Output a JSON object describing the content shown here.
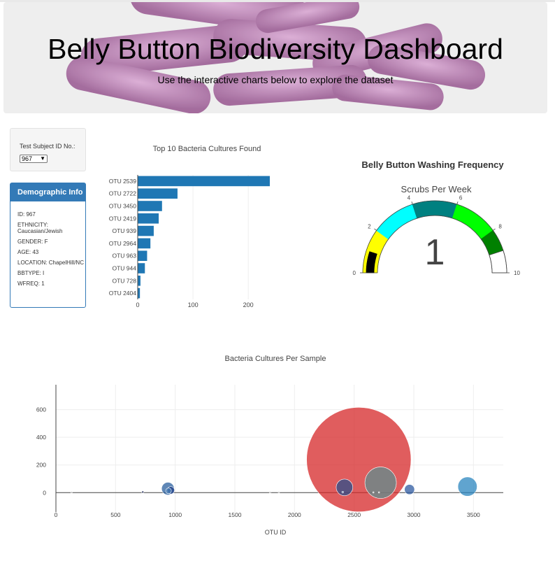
{
  "header": {
    "title": "Belly Button Biodiversity Dashboard",
    "subtitle": "Use the interactive charts below to explore the dataset"
  },
  "selector": {
    "label": "Test Subject ID No.:",
    "value": "967"
  },
  "demographics": {
    "heading": "Demographic Info",
    "rows": [
      "ID: 967",
      "ETHNICITY: Caucasian/Jewish",
      "GENDER: F",
      "AGE: 43",
      "LOCATION: ChapelHill/NC",
      "BBTYPE: I",
      "WFREQ: 1"
    ]
  },
  "colors": {
    "accent": "#337ab7",
    "bar": "#1f77b4",
    "gauge": [
      "#ffff00",
      "#00ffff",
      "#008080",
      "#00ff00",
      "#008000",
      "#ffffff"
    ]
  },
  "chart_data": [
    {
      "type": "bar",
      "orientation": "horizontal",
      "title": "Top 10 Bacteria Cultures Found",
      "categories": [
        "OTU 2539",
        "OTU 2722",
        "OTU 3450",
        "OTU 2419",
        "OTU 939",
        "OTU 2964",
        "OTU 963",
        "OTU 944",
        "OTU 728",
        "OTU 2404"
      ],
      "values": [
        239,
        72,
        44,
        38,
        29,
        23,
        17,
        13,
        5,
        4
      ],
      "xticks": [
        "0",
        "100",
        "200"
      ],
      "xlim": [
        0,
        239
      ]
    },
    {
      "type": "gauge",
      "title": "Belly Button Washing Frequency",
      "subtitle": "Scrubs Per Week",
      "value": 1,
      "value_label": "1",
      "range": [
        0,
        10
      ],
      "tick_labels": [
        "0",
        "2",
        "4",
        "6",
        "8",
        "10"
      ],
      "steps": [
        [
          0,
          2
        ],
        [
          2,
          4
        ],
        [
          4,
          6
        ],
        [
          6,
          8
        ],
        [
          8,
          9
        ],
        [
          9,
          10
        ]
      ]
    },
    {
      "type": "scatter",
      "title": "Bacteria Cultures Per Sample",
      "xlabel": "OTU ID",
      "xticks": [
        "0",
        "500",
        "1000",
        "1500",
        "2000",
        "2500",
        "3000",
        "3500"
      ],
      "yticks": [
        "0",
        "200",
        "400",
        "600"
      ],
      "xlim": [
        0,
        3750
      ],
      "ylim": [
        -140,
        780
      ],
      "points": [
        {
          "x": 2539,
          "y": 239,
          "size": 239,
          "color": "#d62728"
        },
        {
          "x": 2722,
          "y": 72,
          "size": 72,
          "color": "#5f8d8f"
        },
        {
          "x": 3450,
          "y": 44,
          "size": 44,
          "color": "#2b86bf"
        },
        {
          "x": 2419,
          "y": 38,
          "size": 38,
          "color": "#2b4f8c"
        },
        {
          "x": 939,
          "y": 29,
          "size": 29,
          "color": "#2a5f9e"
        },
        {
          "x": 2964,
          "y": 23,
          "size": 23,
          "color": "#2d5aa0"
        },
        {
          "x": 963,
          "y": 17,
          "size": 17,
          "color": "#1f3f88"
        },
        {
          "x": 944,
          "y": 13,
          "size": 13,
          "color": "#4a7fb5"
        },
        {
          "x": 728,
          "y": 5,
          "size": 5,
          "color": "#333c6a"
        },
        {
          "x": 2404,
          "y": 4,
          "size": 4,
          "color": "#6a8fb5"
        },
        {
          "x": 131,
          "y": 2,
          "size": 2,
          "color": "#888888"
        },
        {
          "x": 1795,
          "y": 2,
          "size": 2,
          "color": "#888888"
        },
        {
          "x": 1869,
          "y": 2,
          "size": 2,
          "color": "#888888"
        },
        {
          "x": 2661,
          "y": 2,
          "size": 2,
          "color": "#bbbbbb"
        },
        {
          "x": 2708,
          "y": 2,
          "size": 2,
          "color": "#bbbbbb"
        }
      ]
    }
  ]
}
